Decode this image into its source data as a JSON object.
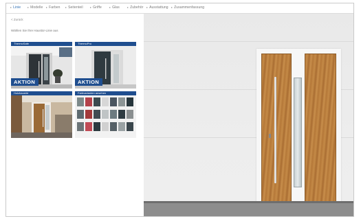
{
  "nav": {
    "tabs": [
      {
        "label": "Linie",
        "active": true
      },
      {
        "label": "Modelle",
        "active": false
      },
      {
        "label": "Farben",
        "active": false
      },
      {
        "label": "Seitenteil",
        "active": false
      },
      {
        "label": "Griffe",
        "active": false
      },
      {
        "label": "Glas",
        "active": false
      },
      {
        "label": "Zubehör",
        "active": false
      },
      {
        "label": "Ausstattung",
        "active": false
      },
      {
        "label": "Zusammenfassung",
        "active": false
      }
    ]
  },
  "left": {
    "back_label": "< Zurück",
    "intro": "Wählen Sie Ihre Haustür-Linie aus",
    "cards": [
      {
        "title": "ThermoSafe",
        "badge": "AKTION"
      },
      {
        "title": "ThermoPro",
        "badge": "AKTION"
      },
      {
        "title": "Holzhaustür",
        "badge": ""
      },
      {
        "title": "Farbvarianten ansehen",
        "badge": ""
      }
    ],
    "swatch_colors": [
      "#7d8a8a",
      "#b3424a",
      "#3b4a4f",
      "#d7d7d7",
      "#4a5560",
      "#8c9596",
      "#27363c",
      "#5e6b70",
      "#a33a3a",
      "#404c52",
      "#bfc4c5",
      "#6d7b80",
      "#2f3c42",
      "#8a8f90",
      "#6b7477",
      "#c04a55",
      "#2d3a40",
      "#d0d0d0",
      "#556066",
      "#9aa2a4",
      "#3a464c"
    ]
  },
  "colors": {
    "accent": "#1f4e8f",
    "active_tab": "#2c6cb0"
  }
}
